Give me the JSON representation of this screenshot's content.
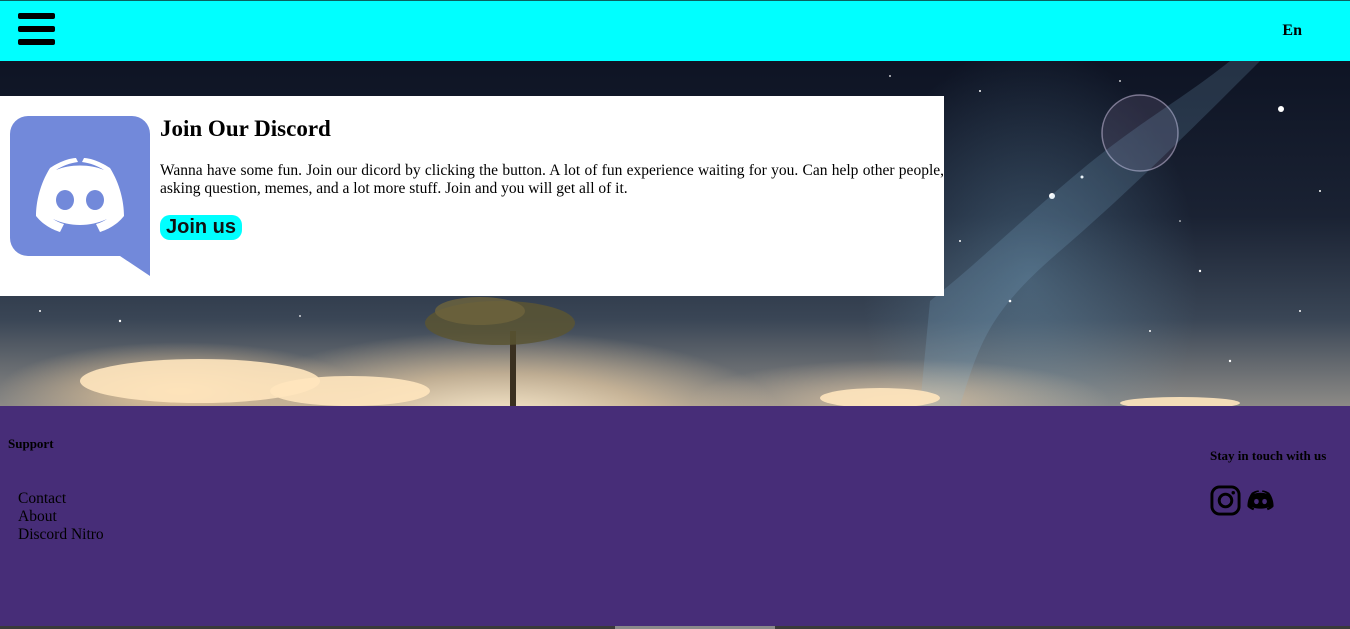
{
  "header": {
    "language": "En"
  },
  "card": {
    "title": "Join Our Discord",
    "text": "Wanna have some fun. Join our dicord by clicking the button. A lot of fun experience waiting for you. Can help other people, asking question, memes, and a lot more stuff. Join and you will get all of it.",
    "button_label": "Join us",
    "logo_color": "#7289da"
  },
  "footer": {
    "support_heading": "Support",
    "links": [
      "Contact",
      "About",
      "Discord Nitro"
    ],
    "social_heading": "Stay in touch with us",
    "icons": [
      "instagram-icon",
      "discord-icon"
    ],
    "background_color": "#472d78"
  },
  "colors": {
    "header_bg": "#00ffff",
    "button_bg": "#00ffff"
  }
}
